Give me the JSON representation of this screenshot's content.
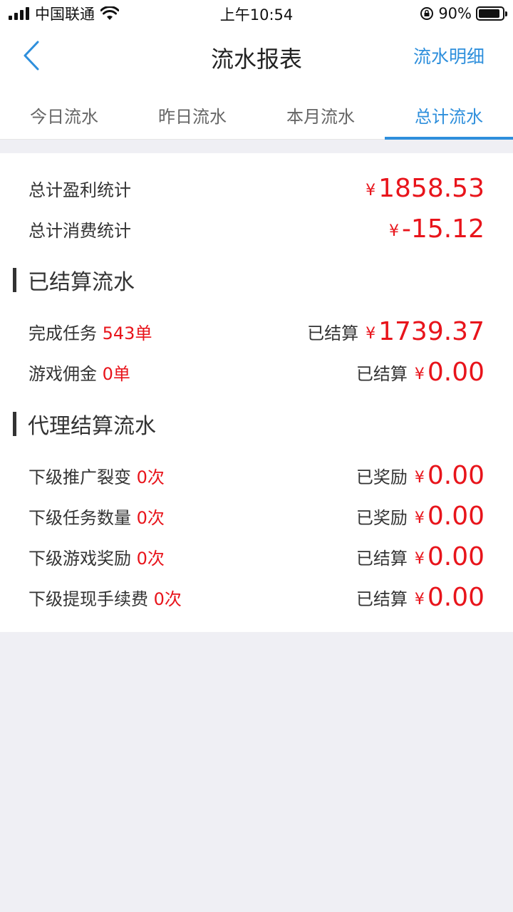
{
  "status_bar": {
    "carrier": "中国联通",
    "time": "上午10:54",
    "battery_percent": "90%",
    "battery_level": 0.9
  },
  "nav": {
    "title": "流水报表",
    "right_link": "流水明细"
  },
  "tabs": [
    {
      "label": "今日流水",
      "active": false
    },
    {
      "label": "昨日流水",
      "active": false
    },
    {
      "label": "本月流水",
      "active": false
    },
    {
      "label": "总计流水",
      "active": true
    }
  ],
  "summary": {
    "profit_label": "总计盈利统计",
    "profit_currency": "¥",
    "profit_amount": "1858.53",
    "consume_label": "总计消费统计",
    "consume_currency": "¥",
    "consume_amount": "-15.12"
  },
  "settled_section": {
    "title": "已结算流水",
    "rows": [
      {
        "label": "完成任务",
        "count": "543单",
        "status": "已结算",
        "currency": "¥",
        "amount": "1739.37"
      },
      {
        "label": "游戏佣金",
        "count": "0单",
        "status": "已结算",
        "currency": "¥",
        "amount": "0.00"
      }
    ]
  },
  "agent_section": {
    "title": "代理结算流水",
    "rows": [
      {
        "label": "下级推广裂变",
        "count": "0次",
        "status": "已奖励",
        "currency": "¥",
        "amount": "0.00"
      },
      {
        "label": "下级任务数量",
        "count": "0次",
        "status": "已奖励",
        "currency": "¥",
        "amount": "0.00"
      },
      {
        "label": "下级游戏奖励",
        "count": "0次",
        "status": "已结算",
        "currency": "¥",
        "amount": "0.00"
      },
      {
        "label": "下级提现手续费",
        "count": "0次",
        "status": "已结算",
        "currency": "¥",
        "amount": "0.00"
      }
    ]
  },
  "colors": {
    "accent": "#2e8fdc",
    "money": "#e8141b",
    "background": "#efeff4"
  }
}
